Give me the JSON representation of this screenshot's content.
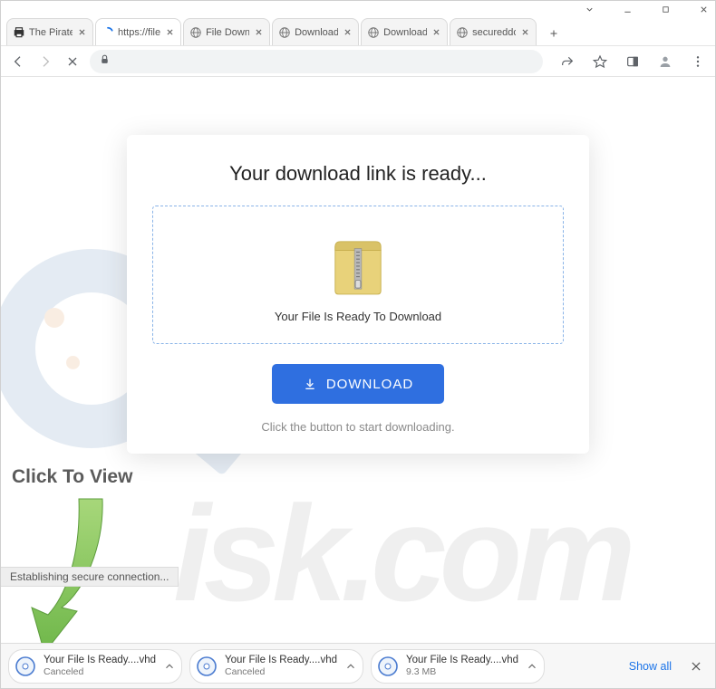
{
  "window": {
    "controls": [
      "dropdown",
      "minimize",
      "maximize",
      "close"
    ]
  },
  "tabs": [
    {
      "title": "The Pirate",
      "active": false,
      "icon": "printer"
    },
    {
      "title": "https://file",
      "active": true,
      "icon": "loading"
    },
    {
      "title": "File Downl",
      "active": false,
      "icon": "globe"
    },
    {
      "title": "Download",
      "active": false,
      "icon": "globe"
    },
    {
      "title": "Download",
      "active": false,
      "icon": "globe"
    },
    {
      "title": "secureddo",
      "active": false,
      "icon": "globe"
    }
  ],
  "toolbar": {
    "back_enabled": true,
    "forward_enabled": false,
    "stop_mode": true,
    "omnibox_secure": true
  },
  "page": {
    "heading": "Your download link is ready...",
    "ready_text": "Your File Is Ready To Download",
    "download_label": "DOWNLOAD",
    "hint": "Click the button to start downloading."
  },
  "overlay": {
    "click_to_view": "Click To View"
  },
  "status": {
    "text": "Establishing secure connection..."
  },
  "downloads": [
    {
      "name": "Your File Is Ready....vhd",
      "sub": "Canceled"
    },
    {
      "name": "Your File Is Ready....vhd",
      "sub": "Canceled"
    },
    {
      "name": "Your File Is Ready....vhd",
      "sub": "9.3 MB"
    }
  ],
  "downloads_bar": {
    "show_all": "Show all"
  },
  "watermark_text": "isk.com"
}
